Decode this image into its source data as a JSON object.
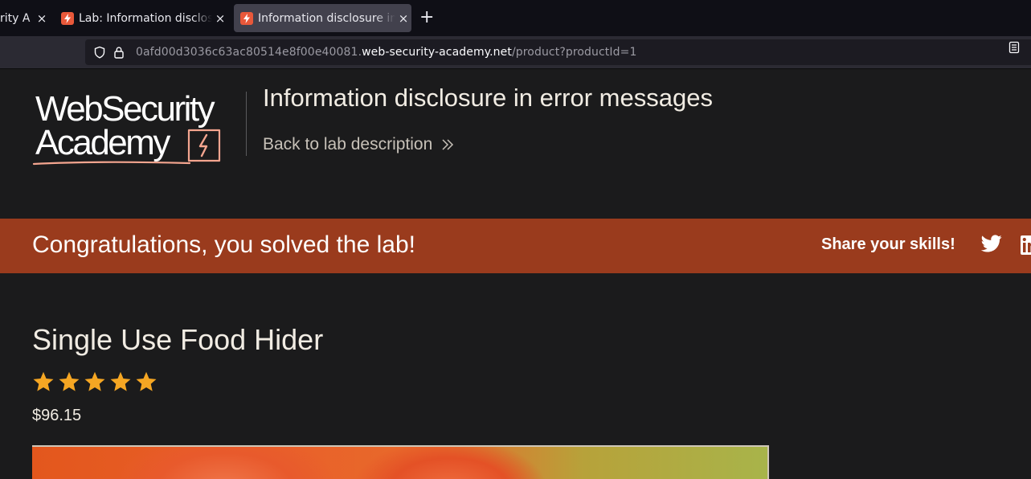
{
  "browser": {
    "tabs": [
      {
        "title": "rity A",
        "active": false
      },
      {
        "title": "Lab: Information disclosu",
        "active": false
      },
      {
        "title": "Information disclosure in",
        "active": true
      }
    ],
    "new_tab_symbol": "+",
    "close_symbol": "×",
    "url_prefix": "0afd00d3036c63ac80514e8f00e40081.",
    "url_host": "web-security-academy.net",
    "url_path": "/product?productId=1"
  },
  "header": {
    "logo_line1": "WebSecurity",
    "logo_line2": "Academy",
    "lab_title": "Information disclosure in error messages",
    "back_link": "Back to lab description"
  },
  "banner": {
    "message": "Congratulations, you solved the lab!",
    "share_label": "Share your skills!",
    "color": "#9a3b1d"
  },
  "product": {
    "title": "Single Use Food Hider",
    "rating": 5,
    "price": "$96.15"
  },
  "colors": {
    "accent_orange": "#e8583a",
    "star": "#f5a623"
  },
  "icons": [
    "shield-icon",
    "lock-icon",
    "reader-view-icon",
    "twitter-icon",
    "linkedin-icon",
    "star-icon",
    "double-chevron-icon"
  ]
}
